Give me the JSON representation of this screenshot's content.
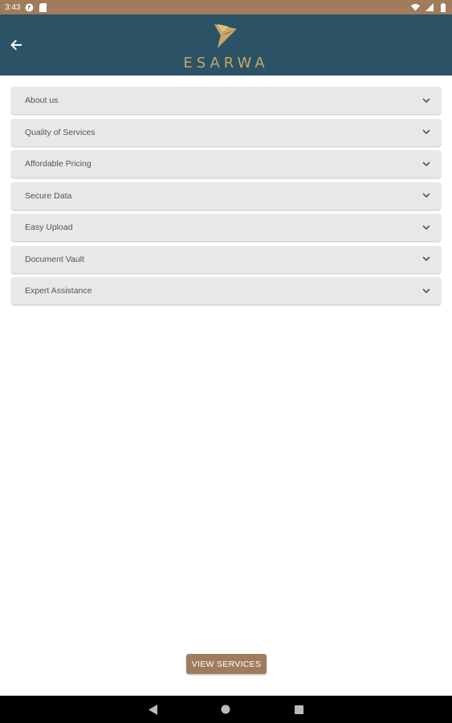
{
  "status_bar": {
    "time": "3:43"
  },
  "app_bar": {
    "logo_text": "ESARWA",
    "accent_color": "#c9a766",
    "background_color": "#2c5266"
  },
  "accordion": {
    "items": [
      {
        "label": "About us"
      },
      {
        "label": "Quality of Services"
      },
      {
        "label": "Affordable Pricing"
      },
      {
        "label": "Secure Data"
      },
      {
        "label": "Easy Upload"
      },
      {
        "label": "Document Vault"
      },
      {
        "label": "Expert Assistance"
      }
    ]
  },
  "view_services_button": {
    "label": "VIEW SERVICES",
    "color": "#a07c5c"
  },
  "icons": {
    "back": "back-arrow-icon",
    "chevron": "chevron-down-icon",
    "nav_back": "nav-back-icon",
    "nav_home": "nav-home-icon",
    "nav_recents": "nav-recents-icon"
  }
}
